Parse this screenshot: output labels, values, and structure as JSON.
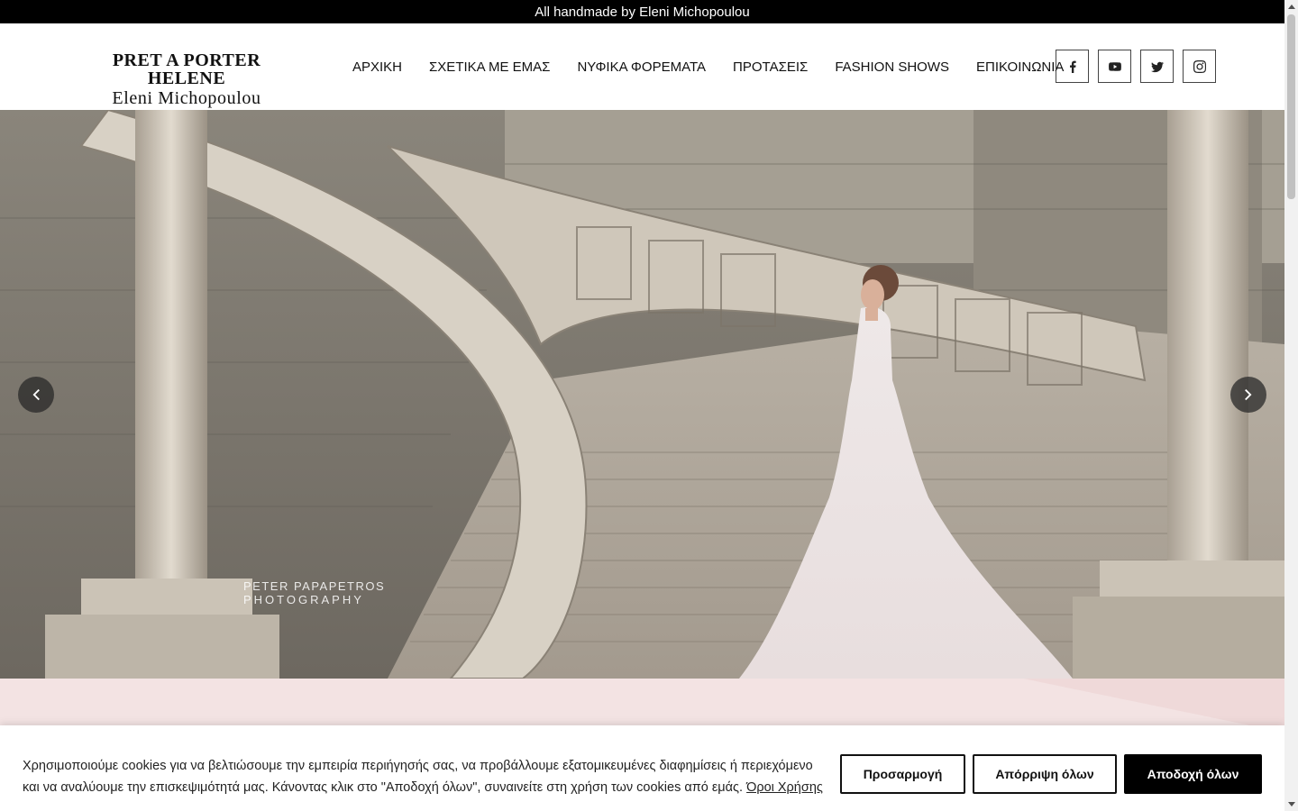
{
  "topbar": {
    "text": "All handmade by Eleni Michopoulou"
  },
  "logo": {
    "line1": "PRET A PORTER HELENE",
    "line2": "Eleni Michopoulou"
  },
  "nav": {
    "items": [
      {
        "label": "ΑΡΧΙΚΗ"
      },
      {
        "label": "ΣΧΕΤΙΚΑ ΜΕ ΕΜΑΣ"
      },
      {
        "label": "ΝΥΦΙΚΑ ΦΟΡΕΜΑΤΑ"
      },
      {
        "label": "ΠΡΟΤΑΣΕΙΣ"
      },
      {
        "label": "FASHION SHOWS"
      },
      {
        "label": "ΕΠΙΚΟΙΝΩΝΙΑ"
      }
    ]
  },
  "social": {
    "icons": [
      "facebook-icon",
      "youtube-icon",
      "twitter-icon",
      "instagram-icon"
    ]
  },
  "hero": {
    "watermark_line1": "PETER   PAPAPETROS",
    "watermark_line2": "PHOTOGRAPHY",
    "prev_icon": "chevron-left-icon",
    "next_icon": "chevron-right-icon"
  },
  "cookie": {
    "text": "Χρησιμοποιούμε cookies για να βελτιώσουμε την εμπειρία περιήγησής σας, να προβάλλουμε εξατομικευμένες διαφημίσεις ή περιεχόμενο και να αναλύουμε την επισκεψιμότητά μας. Κάνοντας κλικ στο \"Αποδοχή όλων\", συναινείτε στη χρήση των cookies από εμάς.",
    "link": "Όροι Χρήσης",
    "customize": "Προσαρμογή",
    "reject": "Απόρριψη όλων",
    "accept": "Αποδοχή όλων"
  },
  "colors": {
    "topbar_bg": "#000000",
    "accent_pink": "#f3e3e3",
    "accept_bg": "#000000"
  }
}
